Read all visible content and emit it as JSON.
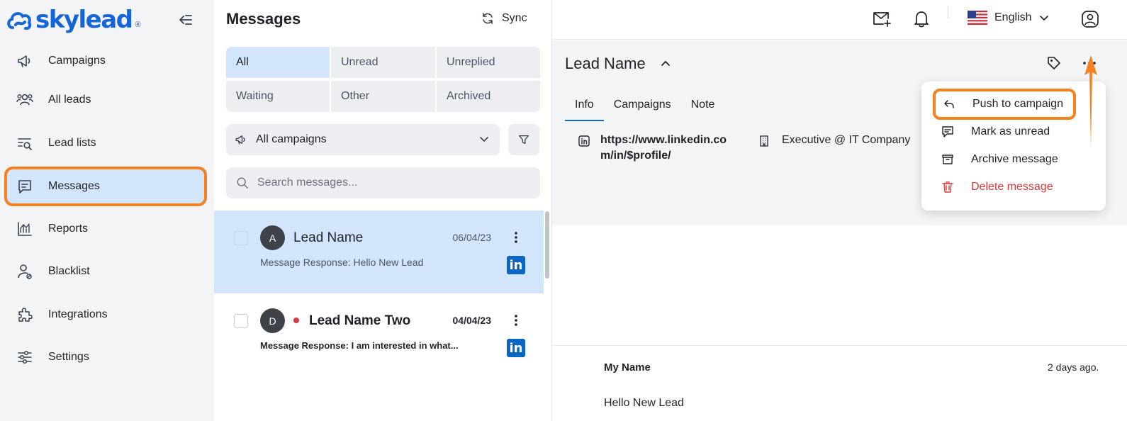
{
  "colors": {
    "accent": "#1565d8",
    "highlight": "#f58220",
    "danger": "#d93a3a",
    "selected_bg": "#d3e5fa",
    "linkedin": "#0a66c2"
  },
  "logo": {
    "text": "skylead",
    "mark": "®"
  },
  "sidebar": {
    "items": [
      {
        "label": "Campaigns",
        "icon": "megaphone-icon"
      },
      {
        "label": "All leads",
        "icon": "users-icon"
      },
      {
        "label": "Lead lists",
        "icon": "list-search-icon"
      },
      {
        "label": "Messages",
        "icon": "message-icon",
        "active": true
      },
      {
        "label": "Reports",
        "icon": "chart-icon"
      },
      {
        "label": "Blacklist",
        "icon": "user-block-icon"
      },
      {
        "label": "Integrations",
        "icon": "puzzle-icon"
      },
      {
        "label": "Settings",
        "icon": "sliders-icon"
      }
    ]
  },
  "messages": {
    "title": "Messages",
    "sync_label": "Sync",
    "filters": [
      "All",
      "Unread",
      "Unreplied",
      "Waiting",
      "Other",
      "Archived"
    ],
    "active_filter": "All",
    "campaign_select": "All campaigns",
    "search_placeholder": "Search messages...",
    "conversations": [
      {
        "initial": "A",
        "name": "Lead Name",
        "date": "06/04/23",
        "preview": "Message Response: Hello New Lead",
        "unread": false,
        "selected": true,
        "channel_icon": "linkedin-icon"
      },
      {
        "initial": "D",
        "name": "Lead Name Two",
        "date": "04/04/23",
        "preview": "Message Response: I am interested in what...",
        "unread": true,
        "selected": false,
        "channel_icon": "linkedin-icon"
      }
    ]
  },
  "topbar": {
    "language": "English"
  },
  "lead": {
    "name": "Lead Name",
    "tabs": [
      "Info",
      "Campaigns",
      "Note"
    ],
    "active_tab": "Info",
    "linkedin_url": "https://www.linkedin.com/in/$profile/",
    "job": "Executive @ IT Company"
  },
  "dropdown": {
    "items": [
      {
        "label": "Push to campaign",
        "icon": "reply-arrow-icon",
        "highlighted": true
      },
      {
        "label": "Mark as unread",
        "icon": "mark-unread-icon"
      },
      {
        "label": "Archive message",
        "icon": "archive-icon"
      },
      {
        "label": "Delete message",
        "icon": "trash-icon",
        "danger": true
      }
    ]
  },
  "message": {
    "sender": "My Name",
    "time_ago": "2 days ago.",
    "body": "Hello New Lead"
  }
}
